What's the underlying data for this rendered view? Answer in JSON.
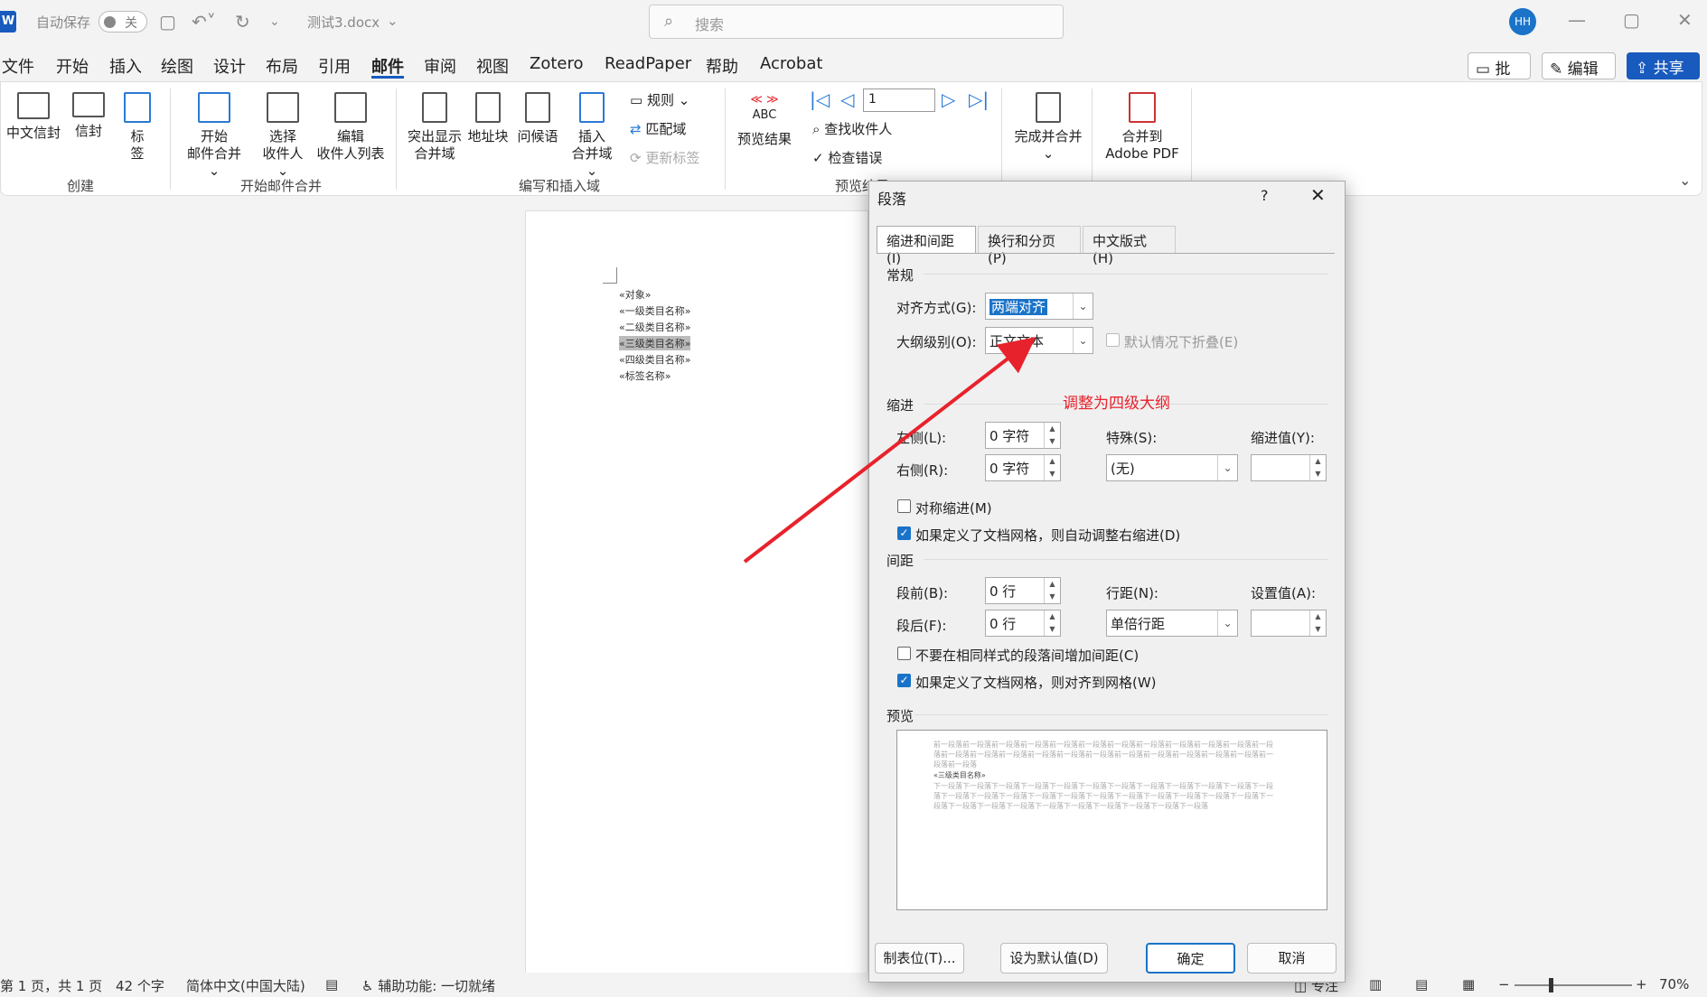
{
  "titlebar": {
    "logo": "W",
    "autosave_label": "自动保存",
    "autosave_state": "关",
    "filename": "测试3.docx",
    "search_placeholder": "搜索",
    "avatar": "HH"
  },
  "menu": {
    "items": [
      "文件",
      "开始",
      "插入",
      "绘图",
      "设计",
      "布局",
      "引用",
      "邮件",
      "审阅",
      "视图",
      "Zotero",
      "ReadPaper",
      "帮助",
      "Acrobat"
    ],
    "active": "邮件",
    "comment_btn": "批注",
    "edit_btn": "编辑",
    "share_btn": "共享"
  },
  "ribbon": {
    "create": {
      "label": "创建",
      "chinese_envelope": "中文信封",
      "envelope": "信封",
      "label_btn1": "标",
      "label_btn2": "签"
    },
    "start_merge": {
      "label": "开始邮件合并",
      "start1": "开始",
      "start2": "邮件合并",
      "select1": "选择",
      "select2": "收件人",
      "edit1": "编辑",
      "edit2": "收件人列表"
    },
    "write_insert": {
      "label": "编写和插入域",
      "highlight1": "突出显示",
      "highlight2": "合并域",
      "address": "地址块",
      "greeting": "问候语",
      "insert1": "插入",
      "insert2": "合并域",
      "rules": "规则",
      "match": "匹配域",
      "update": "更新标签"
    },
    "preview": {
      "label": "预览结果",
      "preview_btn": "预览结果",
      "abc": "ABC",
      "record_no": "1",
      "find": "查找收件人",
      "check": "检查错误"
    },
    "finish": {
      "label1": "完成并合并",
      "label2": "合并到",
      "label3": "Adobe PDF"
    }
  },
  "document": {
    "lines": [
      "«对象»",
      "«一级类目名称»",
      "«二级类目名称»",
      "«三级类目名称»",
      "«四级类目名称»",
      "«标签名称»"
    ],
    "highlighted_index": 3
  },
  "statusbar": {
    "page": "第 1 页，共 1 页",
    "words": "42 个字",
    "lang": "简体中文(中国大陆)",
    "accessibility": "辅助功能: 一切就绪",
    "focus": "专注",
    "zoom": "70%"
  },
  "dialog": {
    "title": "段落",
    "help": "?",
    "tabs": [
      "缩进和间距(I)",
      "换行和分页(P)",
      "中文版式(H)"
    ],
    "general": "常规",
    "align_label": "对齐方式(G):",
    "align_value": "两端对齐",
    "outline_label": "大纲级别(O):",
    "outline_value": "正文文本",
    "collapse_label": "默认情况下折叠(E)",
    "indent": "缩进",
    "left_label": "左侧(L):",
    "left_value": "0 字符",
    "right_label": "右侧(R):",
    "right_value": "0 字符",
    "special_label": "特殊(S):",
    "special_value": "(无)",
    "indent_by_label": "缩进值(Y):",
    "mirror_label": "对称缩进(M)",
    "auto_right_label": "如果定义了文档网格，则自动调整右缩进(D)",
    "spacing": "间距",
    "before_label": "段前(B):",
    "before_value": "0 行",
    "after_label": "段后(F):",
    "after_value": "0 行",
    "line_label": "行距(N):",
    "line_value": "单倍行距",
    "at_label": "设置值(A):",
    "no_space_label": "不要在相同样式的段落间增加间距(C)",
    "snap_grid_label": "如果定义了文档网格，则对齐到网格(W)",
    "preview": "预览",
    "preview_prev": "前一段落前一段落前一段落前一段落前一段落前一段落前一段落前一段落前一段落前一段落前一段落前一段落前一段落前一段落前一段落前一段落前一段落前一段落前一段落前一段落前一段落前一段落前一段落前一段落前一段落",
    "preview_cur": "«三级类目名称»",
    "preview_next": "下一段落下一段落下一段落下一段落下一段落下一段落下一段落下一段落下一段落下一段落下一段落下一段落下一段落下一段落下一段落下一段落下一段落下一段落下一段落下一段落下一段落下一段落下一段落下一段落下一段落下一段落下一段落下一段落下一段落下一段落下一段落下一段落下一段落",
    "tabs_btn": "制表位(T)...",
    "default_btn": "设为默认值(D)",
    "ok_btn": "确定",
    "cancel_btn": "取消"
  },
  "annotation": {
    "text": "调整为四级大纲",
    "color": "#e8222c"
  }
}
